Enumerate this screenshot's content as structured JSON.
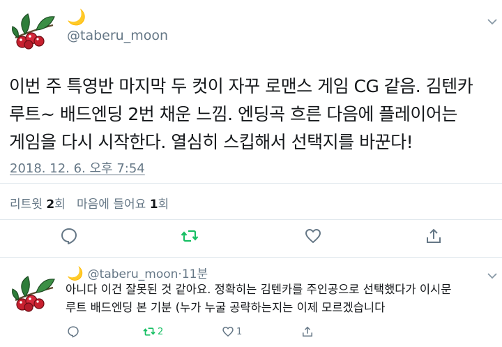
{
  "tweet": {
    "moon": "🌙",
    "handle": "@taberu_moon",
    "text_lines": [
      "이번 주 특영반 마지막 두 컷이 자꾸 로맨스 게임 CG 같음. 김텐카",
      "루트~ 배드엔딩 2번 채운 느낌. 엔딩곡 흐른 다음에 플레이어는",
      "게임을 다시 시작한다. 열심히 스킵해서 선택지를 바꾼다!"
    ],
    "timestamp": "2018. 12. 6. 오후 7:54",
    "stats": {
      "retweets_label": "리트윗",
      "retweets_count": "2",
      "retweets_unit": "회",
      "likes_label": "마음에 들어요",
      "likes_count": "1",
      "likes_unit": "회"
    },
    "actions": {
      "reply_icon": "speech-bubble-icon",
      "retweet_icon": "retweet-icon",
      "like_icon": "heart-icon",
      "share_icon": "share-icon"
    }
  },
  "reply": {
    "moon": "🌙",
    "handle": "@taberu_moon",
    "separator": "·",
    "time": "11분",
    "text_lines": [
      "아니다 이건 잘못된 것 같아요. 정확히는 김텐카를 주인공으로 선택했다가 이시문",
      "루트 배드엔딩 본 기분 (누가 누굴 공략하는지는 이제 모르겠습니다"
    ],
    "retweet_count": "2",
    "like_count": "1"
  },
  "colors": {
    "text": "#14171a",
    "muted": "#657786",
    "retweet_green": "#17bf63",
    "divider": "#e1e8ed",
    "berry_red": "#c8202f",
    "leaf_green": "#2e7d3a"
  }
}
